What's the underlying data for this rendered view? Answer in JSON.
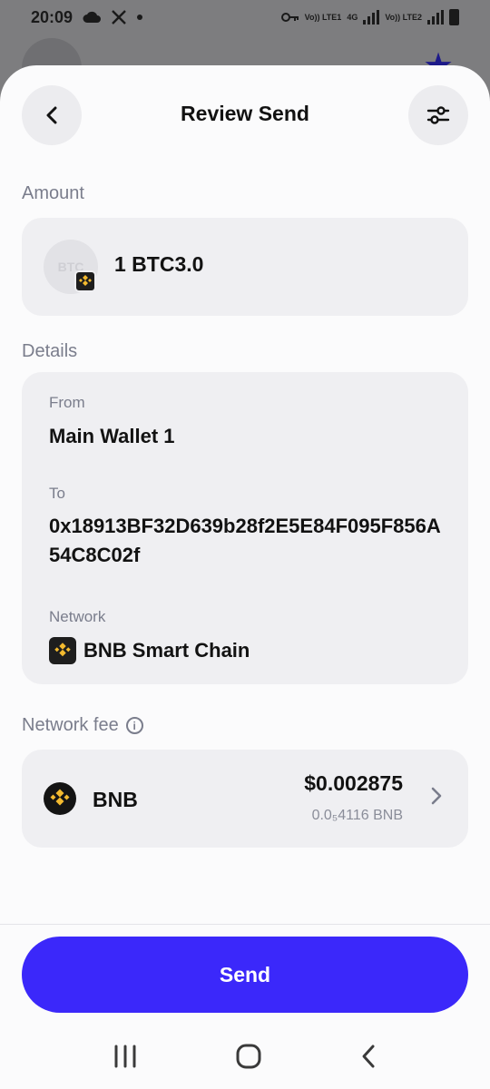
{
  "status_bar": {
    "time": "20:09",
    "left_icons": [
      "cloud-icon",
      "x-logo-icon",
      "dot-icon"
    ],
    "right_icons": [
      "vpn-key-icon",
      "volte-lte1-icon",
      "4g-icon",
      "signal-icon",
      "volte-lte2-icon",
      "signal-icon",
      "battery-icon"
    ],
    "volte1": "Vo)) LTE1",
    "net4g": "4G",
    "volte2": "Vo)) LTE2"
  },
  "header": {
    "title": "Review Send",
    "back_icon": "chevron-left-icon",
    "settings_icon": "sliders-icon"
  },
  "amount": {
    "label": "Amount",
    "coin_placeholder": "BTC",
    "value": "1 BTC3.0"
  },
  "details": {
    "label": "Details",
    "from_label": "From",
    "from_value": "Main Wallet 1",
    "to_label": "To",
    "to_value": "0x18913BF32D639b28f2E5E84F095F856A54C8C02f",
    "network_label": "Network",
    "network_value": "BNB Smart Chain"
  },
  "fee": {
    "label": "Network fee",
    "coin": "BNB",
    "usd": "$0.002875",
    "amount": "0.0₅4116 BNB"
  },
  "send_label": "Send",
  "nav": [
    "recent-apps-icon",
    "home-icon",
    "back-icon"
  ],
  "colors": {
    "accent": "#3b28fa",
    "card": "#efeff2",
    "muted_text": "#7a7d8c",
    "bnb_yellow": "#f3ba2f"
  }
}
